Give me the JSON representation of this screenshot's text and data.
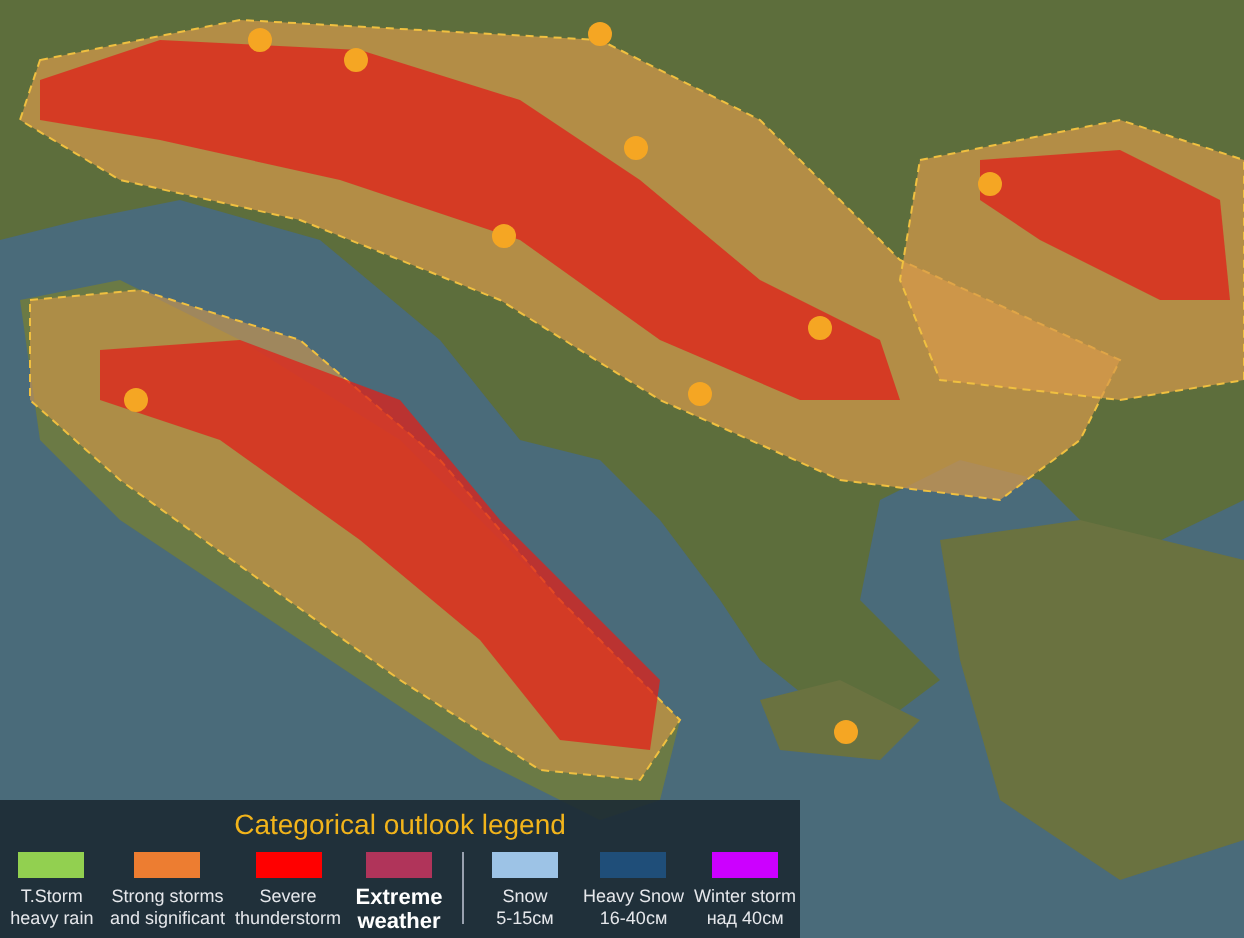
{
  "legend": {
    "title": "Categorical outlook legend",
    "storm_items": [
      {
        "bold": false,
        "color": "#92d050",
        "lines": [
          "T.Storm",
          "heavy rain"
        ]
      },
      {
        "bold": false,
        "color": "#ed7d31",
        "lines": [
          "Strong storms",
          "and significant"
        ]
      },
      {
        "bold": false,
        "color": "#ff0000",
        "lines": [
          "Severe",
          "thunderstorm"
        ]
      },
      {
        "bold": true,
        "color": "#b0345a",
        "lines": [
          "Extreme",
          "weather"
        ]
      }
    ],
    "winter_items": [
      {
        "bold": false,
        "color": "#9dc3e6",
        "lines": [
          "Snow",
          "5-15см"
        ]
      },
      {
        "bold": false,
        "color": "#1f4e79",
        "lines": [
          "Heavy Snow",
          "16-40см"
        ]
      },
      {
        "bold": false,
        "color": "#cc00ff",
        "lines": [
          "Winter storm",
          "над 40см"
        ]
      }
    ]
  }
}
